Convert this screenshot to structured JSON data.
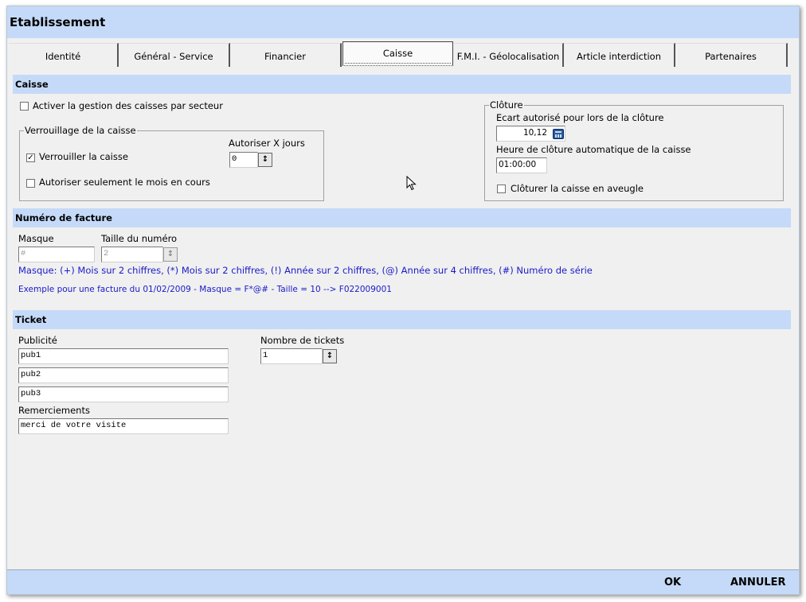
{
  "window": {
    "title": "Etablissement"
  },
  "tabs": [
    {
      "label": "Identité"
    },
    {
      "label": "Général - Service"
    },
    {
      "label": "Financier"
    },
    {
      "label": "Caisse"
    },
    {
      "label": "F.M.I. - Géolocalisation"
    },
    {
      "label": "Article interdiction"
    },
    {
      "label": "Partenaires"
    }
  ],
  "caisse": {
    "header": "Caisse",
    "sector_checkbox_label": "Activer la gestion des caisses par secteur",
    "lock_group": {
      "legend": "Verrouillage de la caisse",
      "lock_label": "Verrouiller la caisse",
      "lock_checked": "✓",
      "month_only_label": "Autoriser seulement le mois en cours",
      "days_label": "Autoriser X jours",
      "days_value": "0"
    },
    "closure_group": {
      "legend": "Clôture",
      "gap_label": "Ecart autorisé pour lors de la clôture",
      "gap_value": "10,12",
      "auto_time_label": "Heure de clôture automatique de la caisse",
      "auto_time_value": "01:00:00",
      "blind_label": "Clôturer la caisse en aveugle"
    }
  },
  "invoice": {
    "header": "Numéro de facture",
    "mask_label": "Masque",
    "mask_value": "#",
    "size_label": "Taille du numéro",
    "size_value": "2",
    "help_line": "Masque: (+) Mois sur 2 chiffres, (*) Mois sur 2 chiffres, (!) Année sur 2 chiffres, (@) Année sur 4 chiffres, (#) Numéro de série",
    "example_line": "Exemple pour une facture du 01/02/2009 - Masque = F*@# - Taille = 10 --> F022009001"
  },
  "ticket": {
    "header": "Ticket",
    "ads_label": "Publicité",
    "ads": [
      "pub1",
      "pub2",
      "pub3"
    ],
    "thanks_label": "Remerciements",
    "thanks_value": "merci de votre visite",
    "count_label": "Nombre de tickets",
    "count_value": "1"
  },
  "footer": {
    "ok_label": "OK",
    "cancel_label": "ANNULER"
  },
  "icons": {
    "spin": "↕",
    "calculator": "calculator-icon"
  },
  "colors": {
    "header_bg": "#c5daf8",
    "link_blue": "#1a1ac8"
  }
}
